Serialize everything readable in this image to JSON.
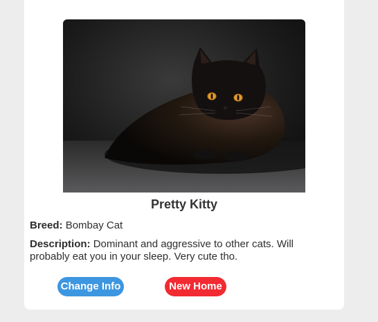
{
  "card": {
    "title": "Pretty Kitty",
    "breed_label": "Breed:",
    "breed_value": "Bombay Cat",
    "description_label": "Description:",
    "description_value": "Dominant and aggressive to other cats. Will probably eat you in your sleep. Very cute tho.",
    "photo_subject": "black-cat-photo"
  },
  "actions": {
    "change_info_label": "Change Info",
    "new_home_label": "New Home"
  },
  "colors": {
    "change_info_button": "#3d96e0",
    "new_home_button": "#f22a32",
    "card_background": "#ffffff",
    "page_background": "#ededed"
  }
}
